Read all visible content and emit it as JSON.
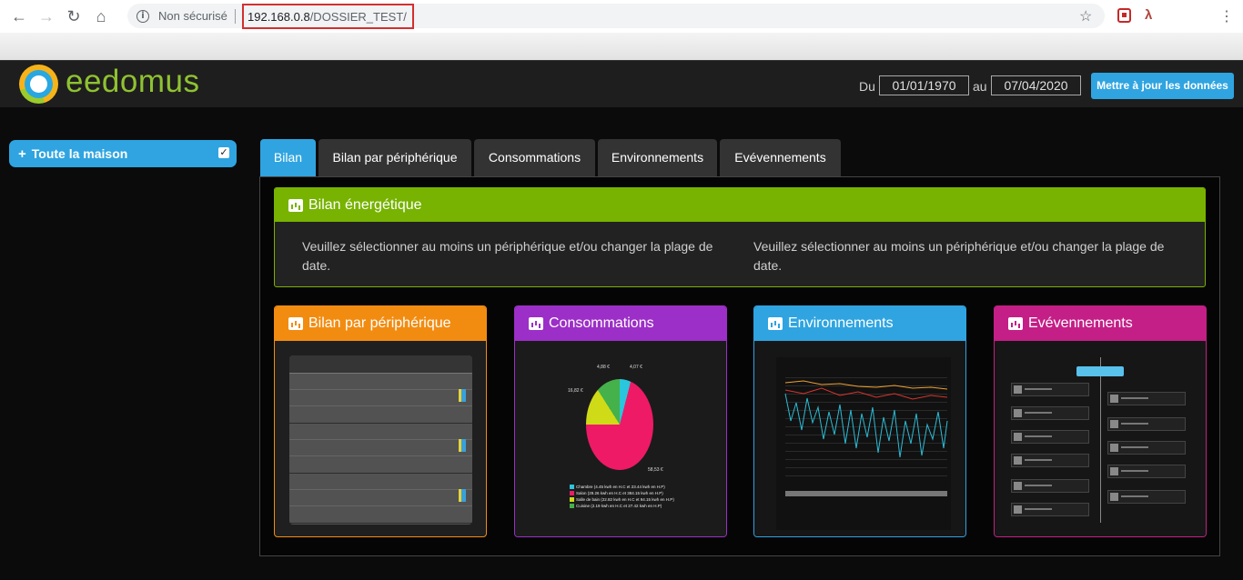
{
  "browser": {
    "security_label": "Non sécurisé",
    "url_host": "192.168.0.8",
    "url_path": "/DOSSIER_TEST/"
  },
  "header": {
    "logo_text": "eedomus",
    "from_label": "Du",
    "from_date": "01/01/1970",
    "to_label": "au",
    "to_date": "07/04/2020",
    "update_button": "Mettre à jour les données"
  },
  "sidebar": {
    "house_label": "Toute la maison",
    "house_checked": true
  },
  "tabs": [
    {
      "label": "Bilan",
      "active": true
    },
    {
      "label": "Bilan par périphérique",
      "active": false
    },
    {
      "label": "Consommations",
      "active": false
    },
    {
      "label": "Environnements",
      "active": false
    },
    {
      "label": "Evévennements",
      "active": false
    }
  ],
  "bilan": {
    "title": "Bilan énergétique",
    "message_left": "Veuillez sélectionner au moins un périphérique et/ou changer la plage de date.",
    "message_right": "Veuillez sélectionner au moins un périphérique et/ou changer la plage de date."
  },
  "cards": [
    {
      "title": "Bilan par périphérique",
      "color": "#f28c11"
    },
    {
      "title": "Consommations",
      "color": "#9c2fc7"
    },
    {
      "title": "Environnements",
      "color": "#2fa4e0"
    },
    {
      "title": "Evévennements",
      "color": "#c41f86"
    }
  ],
  "consommations_preview": {
    "labels": [
      "4,88 €",
      "4,07 €",
      "16,82 €",
      "58,53 €"
    ],
    "legend": [
      {
        "text": "Chambre (4.45 kwh en H.C et 23.44 kwh en H.P)",
        "color": "#29c6dd"
      },
      {
        "text": "Salon (29.26 kwh en H.C et 384.15 kwh en H.P)",
        "color": "#ee1a66"
      },
      {
        "text": "Salle de bain (22.82 kwh en H.C et 94.15 kwh en H.P)",
        "color": "#cfdb17"
      },
      {
        "text": "Cuisine (2.19 kwh en H.C et 27.42 kwh en H.P)",
        "color": "#45b14a"
      }
    ]
  },
  "colors": {
    "accent": "#2fa4e0",
    "bilan_green": "#77b300"
  }
}
